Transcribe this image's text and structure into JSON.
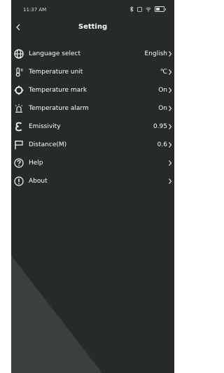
{
  "status_bar": {
    "time": "11:37 AM"
  },
  "header": {
    "title": "Setting"
  },
  "settings": [
    {
      "label": "Language select",
      "value": "English",
      "icon": "globe-icon"
    },
    {
      "label": "Temperature unit",
      "value": "℃",
      "icon": "thermometer-icon"
    },
    {
      "label": "Temperature mark",
      "value": "On",
      "icon": "crosshair-icon"
    },
    {
      "label": "Temperature alarm",
      "value": "On",
      "icon": "alarm-icon"
    },
    {
      "label": "Emissivity",
      "value": "0.95",
      "icon": "epsilon-icon"
    },
    {
      "label": "Distance(M)",
      "value": "0.6",
      "icon": "flag-icon"
    },
    {
      "label": "Help",
      "value": "",
      "icon": "help-icon"
    },
    {
      "label": "About",
      "value": "",
      "icon": "info-icon"
    }
  ],
  "colors": {
    "background": "#262a2b",
    "triangle": "#3a3f40",
    "text": "#ffffff"
  }
}
